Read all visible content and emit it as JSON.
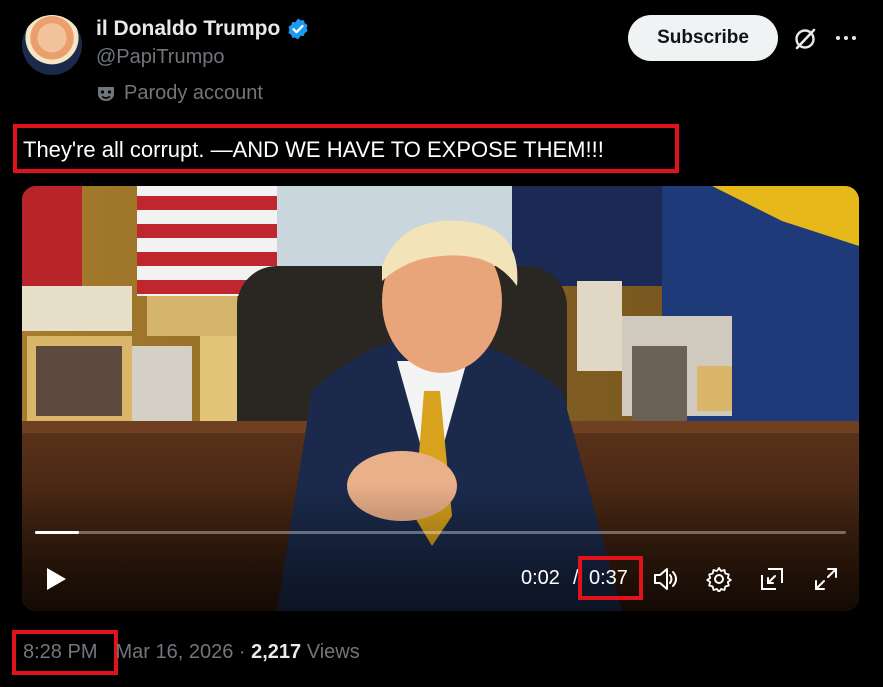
{
  "author": {
    "display_name": "il Donaldo Trumpo",
    "handle": "@PapiTrumpo",
    "label": "Parody account",
    "verified": true
  },
  "actions": {
    "subscribe_label": "Subscribe",
    "grok_icon": "grok-slash-icon",
    "more_icon": "more-horizontal-icon"
  },
  "post": {
    "text": "They're all corrupt. —AND WE HAVE TO EXPOSE THEM!!!"
  },
  "video": {
    "current_time": "0:02",
    "separator": "/",
    "duration": "0:37",
    "progress": 0.054
  },
  "footer": {
    "time": "8:28 PM",
    "date": "Mar 16, 2026",
    "dot": " · ",
    "views_count": "2,217",
    "views_label": " Views"
  },
  "colors": {
    "accent_blue": "#1d9bf0",
    "highlight_red": "#e0131b",
    "muted": "#71767b"
  }
}
